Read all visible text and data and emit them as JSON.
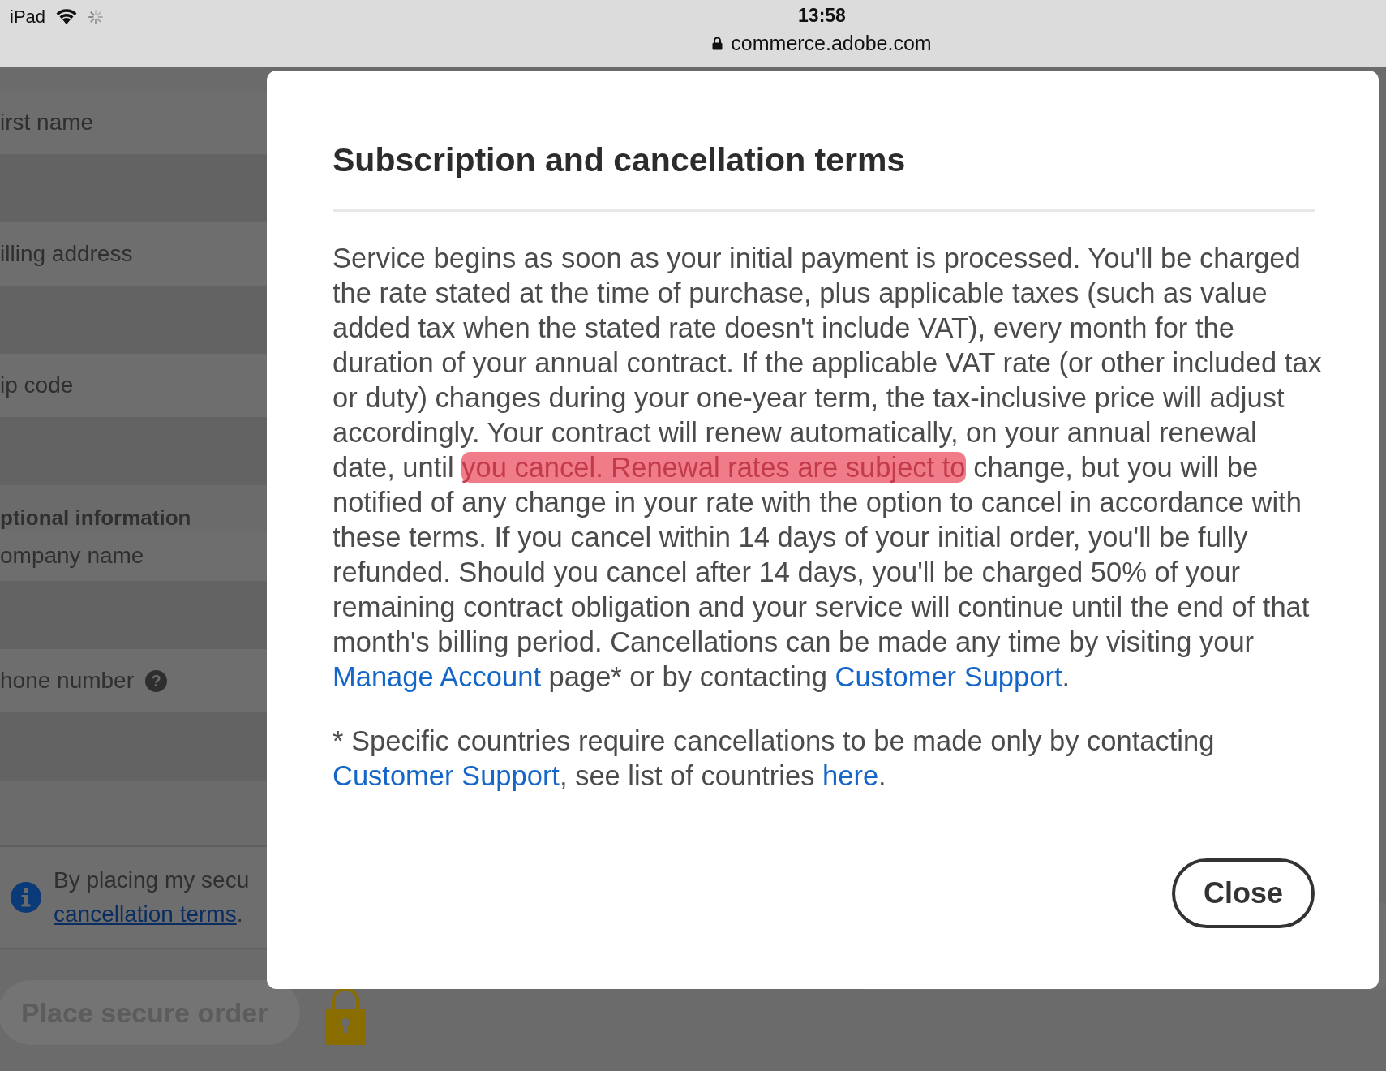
{
  "status_bar": {
    "device": "iPad",
    "time": "13:58",
    "url": "commerce.adobe.com"
  },
  "form": {
    "items": [
      {
        "kind": "field",
        "label": "irst name"
      },
      {
        "kind": "field",
        "label": "illing address"
      },
      {
        "kind": "field",
        "label": "ip code"
      },
      {
        "kind": "heading",
        "label": "ptional information"
      },
      {
        "kind": "field",
        "label": "ompany name"
      },
      {
        "kind": "field",
        "label": "hone number",
        "help": "?"
      }
    ]
  },
  "notice": {
    "text": "By placing my secu",
    "link": "cancellation terms",
    "end": "."
  },
  "order_button": {
    "label": "Place secure order",
    "disabled": true
  },
  "modal": {
    "title": "Subscription and cancellation terms",
    "paragraph": [
      {
        "kind": "text",
        "text": "Service begins as soon as your initial payment is processed. You'll be charged the rate stated at the time of purchase, plus applicable taxes (such as value added tax when the stated rate doesn't include VAT), every month for the duration of your annual contract. If the applicable VAT rate (or other included tax or duty) changes during your one-year term, the tax-inclusive price will adjust accordingly. Your contract will renew automatically, on your annual renewal date, until "
      },
      {
        "kind": "highlight",
        "text": "you cancel. Renewal rates are subject to"
      },
      {
        "kind": "text",
        "text": " change, but you will be notified of any change in your rate with the option to cancel in accordance with these terms. If you cancel within 14 days of your initial order, you'll be fully refunded. Should you cancel after 14 days, you'll be charged 50% of your remaining contract obligation and your service will continue until the end of that month's billing period. Cancellations can be made any time by visiting your "
      },
      {
        "kind": "link",
        "text": "Manage Account"
      },
      {
        "kind": "text",
        "text": " page* or by contacting "
      },
      {
        "kind": "link",
        "text": "Customer Support"
      },
      {
        "kind": "text",
        "text": "."
      }
    ],
    "footnote": [
      {
        "kind": "text",
        "text": "* Specific countries require cancellations to be made only by contacting "
      },
      {
        "kind": "link",
        "text": "Customer Support"
      },
      {
        "kind": "text",
        "text": ", see list of countries "
      },
      {
        "kind": "link",
        "text": "here"
      },
      {
        "kind": "text",
        "text": "."
      }
    ],
    "close_button": "Close"
  }
}
